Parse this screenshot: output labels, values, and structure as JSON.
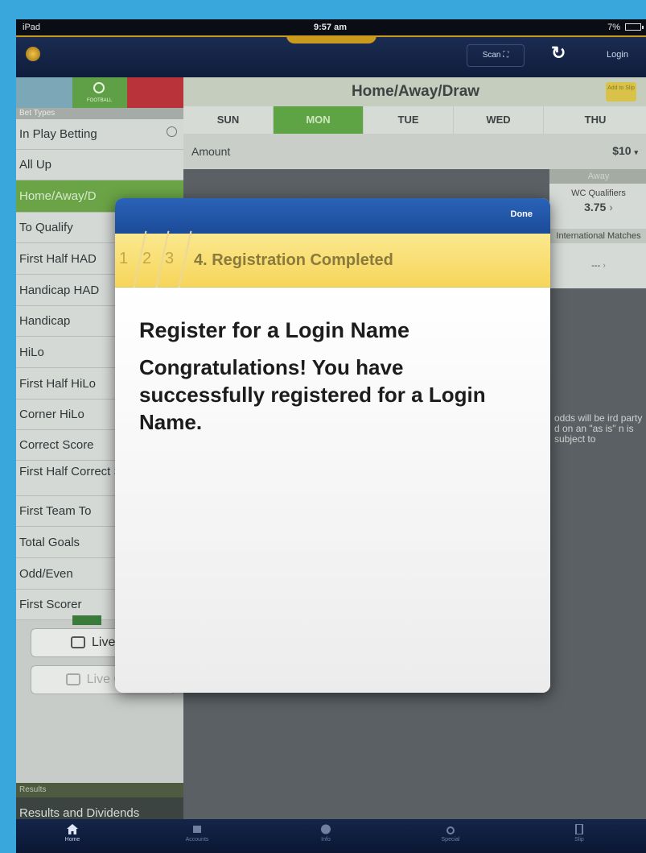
{
  "status": {
    "carrier": "iPad",
    "time": "9:57 am",
    "battery": "7%"
  },
  "header": {
    "scan_label": "Scan",
    "refresh_icon": "refresh-icon",
    "login_label": "Login"
  },
  "sidebar": {
    "sport_caption": "FOOTBALL",
    "bet_types_header": "Bet Types",
    "items": [
      {
        "label": "In Play Betting"
      },
      {
        "label": "All Up"
      },
      {
        "label": "Home/Away/D"
      },
      {
        "label": "To Qualify"
      },
      {
        "label": "First Half HAD"
      },
      {
        "label": "Handicap HAD"
      },
      {
        "label": "Handicap"
      },
      {
        "label": "HiLo"
      },
      {
        "label": "First Half HiLo"
      },
      {
        "label": "Corner HiLo"
      },
      {
        "label": "Correct Score"
      },
      {
        "label": "First Half Correct Score"
      },
      {
        "label": "First Team To"
      },
      {
        "label": "Total Goals"
      },
      {
        "label": "Odd/Even"
      },
      {
        "label": "First Scorer"
      }
    ],
    "live_tv_label": "Live TV",
    "live_cast_label": "Live Cast",
    "results_header": "Results",
    "results_item": "Results and Dividends"
  },
  "content": {
    "title": "Home/Away/Draw",
    "add_button": "Add to Slip",
    "days": [
      "SUN",
      "MON",
      "TUE",
      "WED",
      "THU"
    ],
    "selected_day": "MON",
    "amount_label": "Amount",
    "amount_value": "$10",
    "odds_header": "Away",
    "odds_group1": "WC Qualifiers",
    "odds_value1": "3.75",
    "odds_group2": "International Matches",
    "odds_value2": "---",
    "disclaimer": "odds will be ird party d on an \"as is\" n is subject to"
  },
  "modal": {
    "done_label": "Done",
    "steps": [
      "1",
      "2",
      "3"
    ],
    "step_title": "4. Registration Completed",
    "heading": "Register for a Login Name",
    "message": "Congratulations! You have successfully registered for a Login Name."
  },
  "tabbar": {
    "items": [
      {
        "label": "Home",
        "icon": "home-icon"
      },
      {
        "label": "Accounts",
        "icon": "accounts-icon"
      },
      {
        "label": "Info",
        "icon": "info-icon"
      },
      {
        "label": "Special",
        "icon": "special-icon"
      },
      {
        "label": "Slip",
        "icon": "slip-icon"
      }
    ]
  }
}
